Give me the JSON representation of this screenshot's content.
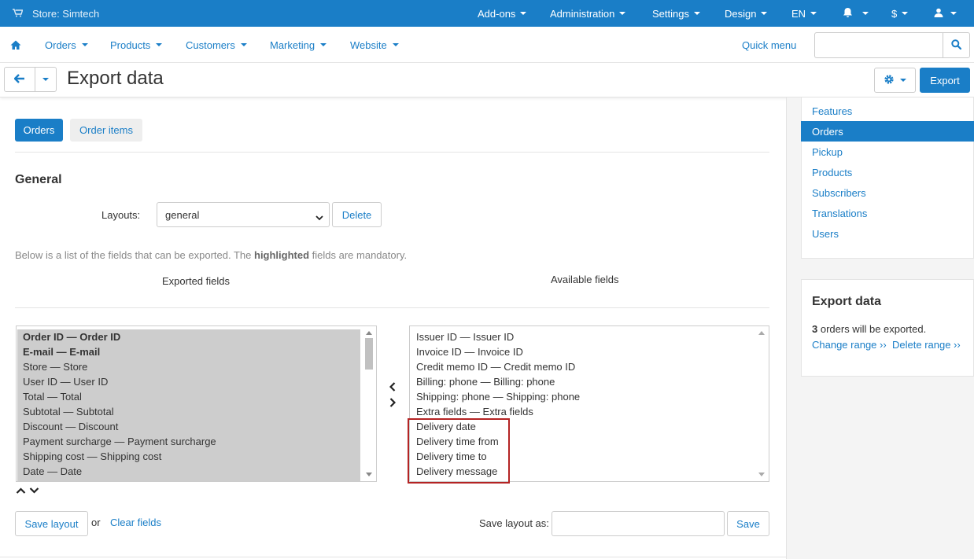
{
  "topbar": {
    "store": "Store: Simtech",
    "items": [
      "Add-ons",
      "Administration",
      "Settings",
      "Design",
      "EN"
    ],
    "currency": "$",
    "icons": [
      "cart-icon",
      "bell-icon",
      "user-icon"
    ]
  },
  "mainnav": {
    "items": [
      "Orders",
      "Products",
      "Customers",
      "Marketing",
      "Website"
    ],
    "quick_menu": "Quick menu",
    "search": {
      "value": "",
      "placeholder": ""
    }
  },
  "page": {
    "title": "Export data",
    "export_button": "Export"
  },
  "tabs": [
    "Orders",
    "Order items"
  ],
  "general": {
    "title": "General",
    "layouts_label": "Layouts:",
    "layout_value": "general",
    "delete_button": "Delete",
    "help_text_before": "Below is a list of the fields that can be exported. The ",
    "help_text_bold": "highlighted",
    "help_text_after": " fields are mandatory.",
    "exported_title": "Exported fields",
    "available_title": "Available fields"
  },
  "exported_fields": [
    {
      "label": "Order ID — Order ID",
      "mandatory": true
    },
    {
      "label": "E-mail — E-mail",
      "mandatory": true
    },
    {
      "label": "Store — Store",
      "mandatory": false
    },
    {
      "label": "User ID — User ID",
      "mandatory": false
    },
    {
      "label": "Total — Total",
      "mandatory": false
    },
    {
      "label": "Subtotal — Subtotal",
      "mandatory": false
    },
    {
      "label": "Discount — Discount",
      "mandatory": false
    },
    {
      "label": "Payment surcharge — Payment surcharge",
      "mandatory": false
    },
    {
      "label": "Shipping cost — Shipping cost",
      "mandatory": false
    },
    {
      "label": "Date — Date",
      "mandatory": false
    }
  ],
  "available_fields": [
    "Issuer ID — Issuer ID",
    "Invoice ID — Invoice ID",
    "Credit memo ID — Credit memo ID",
    "Billing: phone — Billing: phone",
    "Shipping: phone — Shipping: phone",
    "Extra fields — Extra fields",
    "Delivery date",
    "Delivery time from",
    "Delivery time to",
    "Delivery message"
  ],
  "bottom": {
    "save_layout": "Save layout",
    "or": "or",
    "clear_fields": "Clear fields",
    "save_layout_as": "Save layout as:",
    "save": "Save",
    "save_as_value": ""
  },
  "sidebar": {
    "menu": [
      {
        "label": "Features",
        "active": false
      },
      {
        "label": "Orders",
        "active": true
      },
      {
        "label": "Pickup",
        "active": false
      },
      {
        "label": "Products",
        "active": false
      },
      {
        "label": "Subscribers",
        "active": false
      },
      {
        "label": "Translations",
        "active": false
      },
      {
        "label": "Users",
        "active": false
      }
    ],
    "panel": {
      "title": "Export data",
      "count": "3",
      "count_text": " orders will be exported.",
      "change_range": "Change range ››",
      "delete_range": "Delete range ››"
    }
  },
  "colors": {
    "brand": "#1a7ec7",
    "highlight_border": "#b42323"
  }
}
